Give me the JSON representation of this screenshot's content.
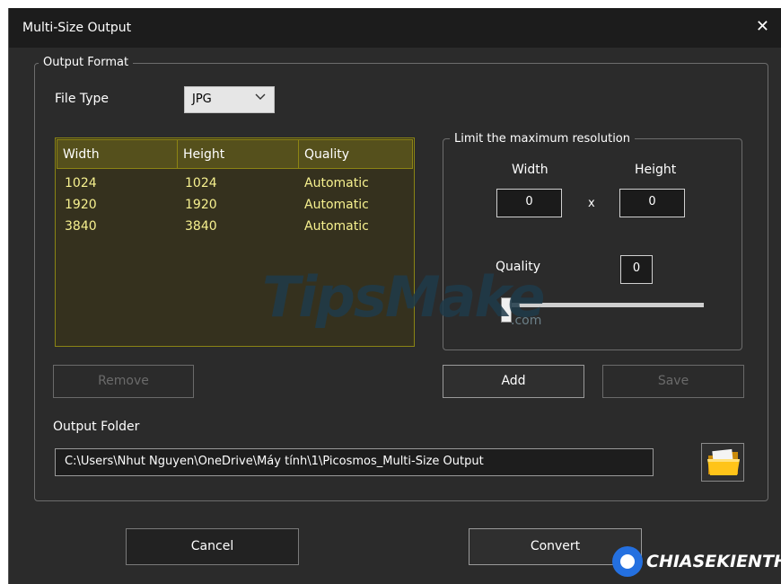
{
  "window": {
    "title": "Multi-Size Output",
    "close_glyph": "✕"
  },
  "output_format": {
    "legend": "Output Format",
    "file_type_label": "File Type",
    "file_type_value": "JPG",
    "table": {
      "columns": [
        "Width",
        "Height",
        "Quality"
      ],
      "rows": [
        [
          "1024",
          "1024",
          "Automatic"
        ],
        [
          "1920",
          "1920",
          "Automatic"
        ],
        [
          "3840",
          "3840",
          "Automatic"
        ]
      ]
    },
    "remove_label": "Remove"
  },
  "limit": {
    "legend": "Limit the maximum resolution",
    "width_label": "Width",
    "height_label": "Height",
    "width_value": "0",
    "height_value": "0",
    "x_label": "x",
    "quality_label": "Quality",
    "quality_value": "0",
    "quality_slider_fraction": 0
  },
  "actions": {
    "add_label": "Add",
    "save_label": "Save"
  },
  "output_folder": {
    "label": "Output Folder",
    "path": "C:\\Users\\Nhut Nguyen\\OneDrive\\Máy tính\\1\\Picosmos_Multi-Size Output"
  },
  "footer": {
    "cancel_label": "Cancel",
    "convert_label": "Convert"
  },
  "watermark": {
    "main": "TipsMake",
    "sub": ".com"
  },
  "brand": {
    "text": "CHIASEKIENTHUC"
  },
  "colors": {
    "table_bg": "#35311e",
    "table_header": "#55501c",
    "table_text": "#f7f18f",
    "accent_blue": "#2470e0"
  },
  "icons": {
    "close": "close-icon",
    "dropdown": "chevron-down-icon",
    "folder": "folder-icon"
  }
}
